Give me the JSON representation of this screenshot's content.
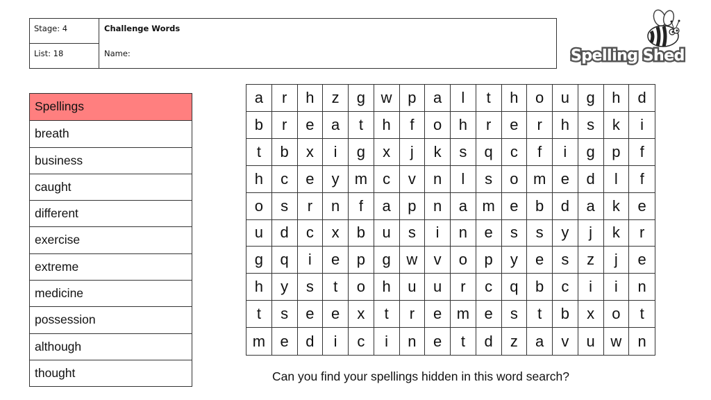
{
  "header": {
    "stage_label": "Stage: 4",
    "list_label": "List: 18",
    "title": "Challenge Words",
    "name_label": "Name:"
  },
  "logo": {
    "text": "Spelling Shed",
    "icon": "bee-icon"
  },
  "spellings": {
    "header": "Spellings",
    "header_color": "#ff7f7f",
    "words": [
      "breath",
      "business",
      "caught",
      "different",
      "exercise",
      "extreme",
      "medicine",
      "possession",
      "although",
      "thought"
    ]
  },
  "grid": {
    "rows": [
      [
        "a",
        "r",
        "h",
        "z",
        "g",
        "w",
        "p",
        "a",
        "l",
        "t",
        "h",
        "o",
        "u",
        "g",
        "h",
        "d"
      ],
      [
        "b",
        "r",
        "e",
        "a",
        "t",
        "h",
        "f",
        "o",
        "h",
        "r",
        "e",
        "r",
        "h",
        "s",
        "k",
        "i"
      ],
      [
        "t",
        "b",
        "x",
        "i",
        "g",
        "x",
        "j",
        "k",
        "s",
        "q",
        "c",
        "f",
        "i",
        "g",
        "p",
        "f"
      ],
      [
        "h",
        "c",
        "e",
        "y",
        "m",
        "c",
        "v",
        "n",
        "l",
        "s",
        "o",
        "m",
        "e",
        "d",
        "l",
        "f"
      ],
      [
        "o",
        "s",
        "r",
        "n",
        "f",
        "a",
        "p",
        "n",
        "a",
        "m",
        "e",
        "b",
        "d",
        "a",
        "k",
        "e"
      ],
      [
        "u",
        "d",
        "c",
        "x",
        "b",
        "u",
        "s",
        "i",
        "n",
        "e",
        "s",
        "s",
        "y",
        "j",
        "k",
        "r"
      ],
      [
        "g",
        "q",
        "i",
        "e",
        "p",
        "g",
        "w",
        "v",
        "o",
        "p",
        "y",
        "e",
        "s",
        "z",
        "j",
        "e"
      ],
      [
        "h",
        "y",
        "s",
        "t",
        "o",
        "h",
        "u",
        "u",
        "r",
        "c",
        "q",
        "b",
        "c",
        "i",
        "i",
        "n"
      ],
      [
        "t",
        "s",
        "e",
        "e",
        "x",
        "t",
        "r",
        "e",
        "m",
        "e",
        "s",
        "t",
        "b",
        "x",
        "o",
        "t"
      ],
      [
        "m",
        "e",
        "d",
        "i",
        "c",
        "i",
        "n",
        "e",
        "t",
        "d",
        "z",
        "a",
        "v",
        "u",
        "w",
        "n"
      ]
    ]
  },
  "footer": {
    "instruction": "Can you find your spellings hidden in this word search?"
  }
}
